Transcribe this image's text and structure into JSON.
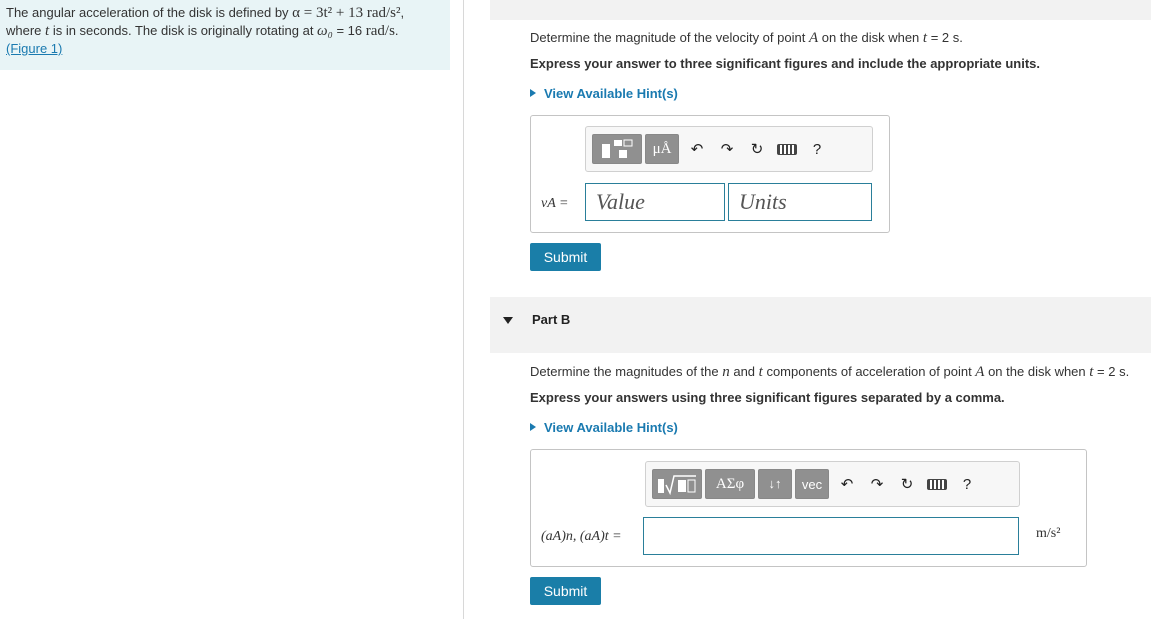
{
  "problem": {
    "line1_prefix": "The angular acceleration of the disk is defined by ",
    "line1_math": "α = 3t² + 13 rad/s²",
    "line1_suffix": ",",
    "line2_prefix": "where ",
    "line2_var": "t",
    "line2_mid": " is in seconds. The disk is originally rotating at ",
    "line2_omega": "ω₀",
    "line2_eq": " = 16 ",
    "line2_unit": "rad/s",
    "line2_end": ".",
    "figure_link": "(Figure 1)"
  },
  "partA": {
    "prompt_prefix": "Determine the magnitude of the velocity of point ",
    "prompt_point": "A",
    "prompt_mid": " on the disk when ",
    "prompt_t": "t",
    "prompt_end": " = 2 s.",
    "instruction": "Express your answer to three significant figures and include the appropriate units.",
    "hint": "View Available Hint(s)",
    "toolbar": {
      "template_icon": "fraction-template-icon",
      "units_btn": "μÅ",
      "help": "?"
    },
    "var_label": "vA =",
    "value_placeholder": "Value",
    "units_placeholder": "Units",
    "submit": "Submit"
  },
  "partB": {
    "title": "Part B",
    "prompt_prefix": "Determine the magnitudes of the ",
    "prompt_n": "n",
    "prompt_and": " and ",
    "prompt_t2": "t",
    "prompt_mid": " components of acceleration of point ",
    "prompt_point": "A",
    "prompt_when": " on the disk when ",
    "prompt_t": "t",
    "prompt_end": " = 2 s.",
    "instruction": "Express your answers using three significant figures separated by a comma.",
    "hint": "View Available Hint(s)",
    "toolbar": {
      "symbols_btn": "ΑΣφ",
      "arrows_btn": "↓↑",
      "vec_btn": "vec",
      "help": "?"
    },
    "var_label": "(aA)n, (aA)t =",
    "input_value": "",
    "unit": "m/s²",
    "submit": "Submit"
  }
}
